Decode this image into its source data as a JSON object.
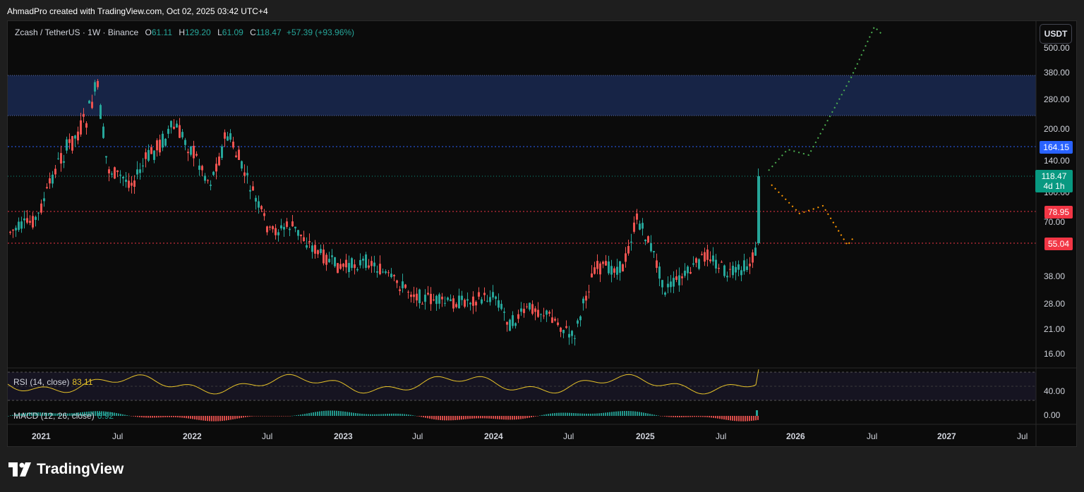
{
  "credit": "AhmadPro created with TradingView.com, Oct 02, 2025 03:42 UTC+4",
  "legend": {
    "symbol": "Zcash / TetherUS · 1W · Binance",
    "o_label": "O",
    "o_value": "61.11",
    "h_label": "H",
    "h_value": "129.20",
    "l_label": "L",
    "l_value": "61.09",
    "c_label": "C",
    "c_value": "118.47",
    "change": "+57.39 (+93.96%)"
  },
  "currency_button": "USDT",
  "price_axis": [
    "500.00",
    "380.00",
    "280.00",
    "200.00",
    "140.00",
    "100.00",
    "70.00",
    "38.00",
    "28.00",
    "21.00",
    "16.00"
  ],
  "price_tags": {
    "resistance": "164.15",
    "current": "118.47",
    "countdown": "4d 1h",
    "mid_level": "78.95",
    "support": "55.04"
  },
  "rsi": {
    "label": "RSI (14, close)",
    "value": "83.11",
    "axis": "40.00"
  },
  "macd": {
    "label": "MACD (12, 26, close)",
    "value": "6.92",
    "axis": "0.00"
  },
  "time_axis": [
    "2021",
    "Jul",
    "2022",
    "Jul",
    "2023",
    "Jul",
    "2024",
    "Jul",
    "2025",
    "Jul",
    "2026",
    "Jul",
    "2027",
    "Jul"
  ],
  "brand": "TradingView",
  "colors": {
    "up": "#26a69a",
    "down": "#ef5350",
    "zone": "#172446",
    "resistance_tag": "#2962ff",
    "support_tag": "#f23645",
    "bull_path": "#4caf50",
    "bear_path": "#ff9800",
    "rsi_line": "#e6c229"
  }
}
